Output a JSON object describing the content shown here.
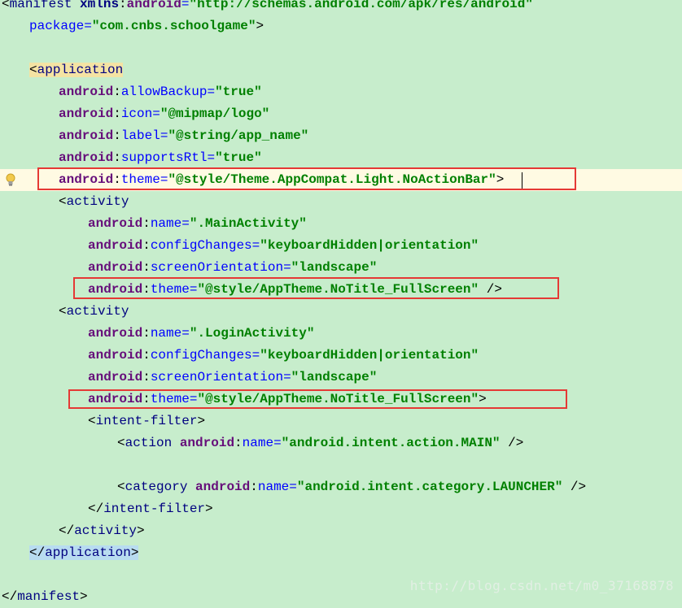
{
  "lines": [
    {
      "segs": [
        {
          "c": "br",
          "t": "<"
        },
        {
          "c": "tg",
          "t": "manifest "
        },
        {
          "c": "p",
          "t": "xmlns"
        },
        {
          "c": "br",
          "t": ":"
        },
        {
          "c": "nm",
          "t": "android"
        },
        {
          "c": "at",
          "t": "="
        },
        {
          "c": "v",
          "t": "\"http://schemas.android.com/apk/res/android\""
        }
      ]
    },
    {
      "segs": [
        {
          "c": "at",
          "t": "package"
        },
        {
          "c": "at",
          "t": "="
        },
        {
          "c": "v",
          "t": "\"com.cnbs.schoolgame\""
        },
        {
          "c": "br",
          "t": ">"
        }
      ]
    },
    {
      "segs": []
    },
    {
      "segs": [
        {
          "c": "br tag-hl2",
          "t": "<"
        },
        {
          "c": "tg tag-hl2",
          "t": "application"
        }
      ]
    },
    {
      "segs": [
        {
          "c": "nm",
          "t": "android"
        },
        {
          "c": "br",
          "t": ":"
        },
        {
          "c": "at",
          "t": "allowBackup"
        },
        {
          "c": "at",
          "t": "="
        },
        {
          "c": "v",
          "t": "\"true\""
        }
      ]
    },
    {
      "segs": [
        {
          "c": "nm",
          "t": "android"
        },
        {
          "c": "br",
          "t": ":"
        },
        {
          "c": "at",
          "t": "icon"
        },
        {
          "c": "at",
          "t": "="
        },
        {
          "c": "v",
          "t": "\"@mipmap/logo\""
        }
      ]
    },
    {
      "segs": [
        {
          "c": "nm",
          "t": "android"
        },
        {
          "c": "br",
          "t": ":"
        },
        {
          "c": "at",
          "t": "label"
        },
        {
          "c": "at",
          "t": "="
        },
        {
          "c": "v",
          "t": "\"@string/app_name\""
        }
      ]
    },
    {
      "segs": [
        {
          "c": "nm",
          "t": "android"
        },
        {
          "c": "br",
          "t": ":"
        },
        {
          "c": "at",
          "t": "supportsRtl"
        },
        {
          "c": "at",
          "t": "="
        },
        {
          "c": "v",
          "t": "\"true\""
        }
      ]
    },
    {
      "segs": [
        {
          "c": "nm",
          "t": "android"
        },
        {
          "c": "br",
          "t": ":"
        },
        {
          "c": "at",
          "t": "theme"
        },
        {
          "c": "at",
          "t": "="
        },
        {
          "c": "v",
          "t": "\"@style/Theme.AppCompat.Light.NoActionBar\""
        },
        {
          "c": "br",
          "t": ">"
        }
      ]
    },
    {
      "segs": [
        {
          "c": "br",
          "t": "<"
        },
        {
          "c": "tg",
          "t": "activity"
        }
      ]
    },
    {
      "segs": [
        {
          "c": "nm",
          "t": "android"
        },
        {
          "c": "br",
          "t": ":"
        },
        {
          "c": "at",
          "t": "name"
        },
        {
          "c": "at",
          "t": "="
        },
        {
          "c": "v",
          "t": "\".MainActivity\""
        }
      ]
    },
    {
      "segs": [
        {
          "c": "nm",
          "t": "android"
        },
        {
          "c": "br",
          "t": ":"
        },
        {
          "c": "at",
          "t": "configChanges"
        },
        {
          "c": "at",
          "t": "="
        },
        {
          "c": "v",
          "t": "\"keyboardHidden|orientation\""
        }
      ]
    },
    {
      "segs": [
        {
          "c": "nm",
          "t": "android"
        },
        {
          "c": "br",
          "t": ":"
        },
        {
          "c": "at",
          "t": "screenOrientation"
        },
        {
          "c": "at",
          "t": "="
        },
        {
          "c": "v",
          "t": "\"landscape\""
        }
      ]
    },
    {
      "segs": [
        {
          "c": "nm",
          "t": "android"
        },
        {
          "c": "br",
          "t": ":"
        },
        {
          "c": "at",
          "t": "theme"
        },
        {
          "c": "at",
          "t": "="
        },
        {
          "c": "v",
          "t": "\"@style/AppTheme.NoTitle_FullScreen\""
        },
        {
          "c": "br",
          "t": " />"
        }
      ]
    },
    {
      "segs": [
        {
          "c": "br",
          "t": "<"
        },
        {
          "c": "tg",
          "t": "activity"
        }
      ]
    },
    {
      "segs": [
        {
          "c": "nm",
          "t": "android"
        },
        {
          "c": "br",
          "t": ":"
        },
        {
          "c": "at",
          "t": "name"
        },
        {
          "c": "at",
          "t": "="
        },
        {
          "c": "v",
          "t": "\".LoginActivity\""
        }
      ]
    },
    {
      "segs": [
        {
          "c": "nm",
          "t": "android"
        },
        {
          "c": "br",
          "t": ":"
        },
        {
          "c": "at",
          "t": "configChanges"
        },
        {
          "c": "at",
          "t": "="
        },
        {
          "c": "v",
          "t": "\"keyboardHidden|orientation\""
        }
      ]
    },
    {
      "segs": [
        {
          "c": "nm",
          "t": "android"
        },
        {
          "c": "br",
          "t": ":"
        },
        {
          "c": "at",
          "t": "screenOrientation"
        },
        {
          "c": "at",
          "t": "="
        },
        {
          "c": "v",
          "t": "\"landscape\""
        }
      ]
    },
    {
      "segs": [
        {
          "c": "nm",
          "t": "android"
        },
        {
          "c": "br",
          "t": ":"
        },
        {
          "c": "at",
          "t": "theme"
        },
        {
          "c": "at",
          "t": "="
        },
        {
          "c": "v",
          "t": "\"@style/AppTheme.NoTitle_FullScreen\""
        },
        {
          "c": "br",
          "t": ">"
        }
      ]
    },
    {
      "segs": [
        {
          "c": "br",
          "t": "<"
        },
        {
          "c": "tg",
          "t": "intent-filter"
        },
        {
          "c": "br",
          "t": ">"
        }
      ]
    },
    {
      "segs": [
        {
          "c": "br",
          "t": "<"
        },
        {
          "c": "tg",
          "t": "action "
        },
        {
          "c": "nm",
          "t": "android"
        },
        {
          "c": "br",
          "t": ":"
        },
        {
          "c": "at",
          "t": "name"
        },
        {
          "c": "at",
          "t": "="
        },
        {
          "c": "v",
          "t": "\"android.intent.action.MAIN\""
        },
        {
          "c": "br",
          "t": " />"
        }
      ]
    },
    {
      "segs": []
    },
    {
      "segs": [
        {
          "c": "br",
          "t": "<"
        },
        {
          "c": "tg",
          "t": "category "
        },
        {
          "c": "nm",
          "t": "android"
        },
        {
          "c": "br",
          "t": ":"
        },
        {
          "c": "at",
          "t": "name"
        },
        {
          "c": "at",
          "t": "="
        },
        {
          "c": "v",
          "t": "\"android.intent.category.LAUNCHER\""
        },
        {
          "c": "br",
          "t": " />"
        }
      ]
    },
    {
      "segs": [
        {
          "c": "br",
          "t": "</"
        },
        {
          "c": "tg",
          "t": "intent-filter"
        },
        {
          "c": "br",
          "t": ">"
        }
      ]
    },
    {
      "segs": [
        {
          "c": "br",
          "t": "</"
        },
        {
          "c": "tg",
          "t": "activity"
        },
        {
          "c": "br",
          "t": ">"
        }
      ]
    },
    {
      "segs": [
        {
          "c": "br tag-hl",
          "t": "</"
        },
        {
          "c": "tg tag-hl",
          "t": "application"
        },
        {
          "c": "br tag-hl",
          "t": ">"
        }
      ]
    },
    {
      "segs": []
    },
    {
      "segs": [
        {
          "c": "br",
          "t": "</"
        },
        {
          "c": "tg",
          "t": "manifest"
        },
        {
          "c": "br",
          "t": ">"
        }
      ]
    }
  ],
  "watermark": "http://blog.csdn.net/m0_37168878",
  "colors": {
    "background": "#c7edcc",
    "caret_line": "#fffae3",
    "highlight_box": "#e53935",
    "string_value": "#008000",
    "namespace": "#660e7a",
    "attribute": "#0000ff",
    "tag": "#000080"
  },
  "icons": {
    "intention_bulb": "lightbulb-icon"
  }
}
